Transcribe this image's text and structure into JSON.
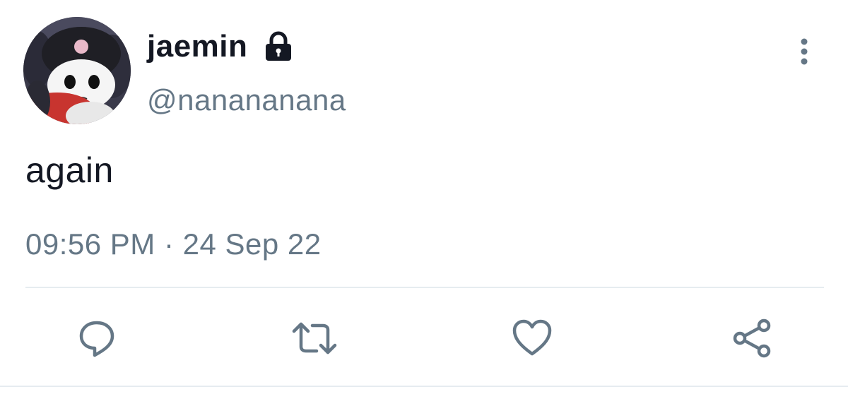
{
  "tweet": {
    "author": {
      "display_name": "jaemin",
      "handle": "@nanananana",
      "protected_account_icon": "lock-icon",
      "avatar_icon": "avatar"
    },
    "more_icon": "more-vertical-icon",
    "text": "again",
    "timestamp": "09:56 PM · 24 Sep 22",
    "actions": [
      {
        "name": "reply",
        "icon": "reply-icon"
      },
      {
        "name": "retweet",
        "icon": "retweet-icon"
      },
      {
        "name": "like",
        "icon": "heart-icon"
      },
      {
        "name": "share",
        "icon": "share-icon"
      }
    ]
  },
  "colors": {
    "primary_text": "#141823",
    "secondary_text": "#657786",
    "divider": "#e6ecf0",
    "icon": "#657786"
  }
}
